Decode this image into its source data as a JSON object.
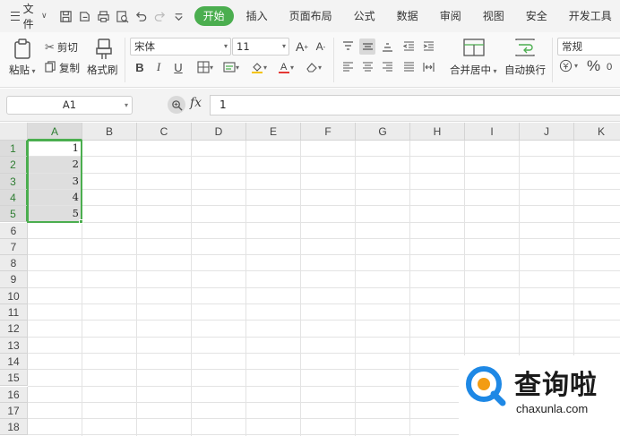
{
  "menubar": {
    "file_label": "文件",
    "tabs": [
      {
        "label": "开始"
      },
      {
        "label": "插入"
      },
      {
        "label": "页面布局"
      },
      {
        "label": "公式"
      },
      {
        "label": "数据"
      },
      {
        "label": "审阅"
      },
      {
        "label": "视图"
      },
      {
        "label": "安全"
      },
      {
        "label": "开发工具"
      }
    ],
    "active_tab": "开始",
    "accent_color": "#4bae4f"
  },
  "ribbon": {
    "paste_label": "粘贴",
    "cut_label": "剪切",
    "copy_label": "复制",
    "format_painter_label": "格式刷",
    "font_name": "宋体",
    "font_size": "11",
    "bold": "B",
    "italic": "I",
    "underline": "U",
    "merge_label": "合并居中",
    "wrap_label": "自动换行",
    "number_format": "常规",
    "percent_symbol": "%"
  },
  "formula_bar": {
    "name_box": "A1",
    "fx_label": "fx",
    "formula_value": "1"
  },
  "sheet": {
    "columns": [
      "A",
      "B",
      "C",
      "D",
      "E",
      "F",
      "G",
      "H",
      "I",
      "J",
      "K"
    ],
    "rows": [
      "1",
      "2",
      "3",
      "4",
      "5",
      "6",
      "7",
      "8",
      "9",
      "10",
      "11",
      "12",
      "13",
      "14",
      "15",
      "16",
      "17",
      "18"
    ],
    "selected_column": "A",
    "selected_rows": [
      "1",
      "2",
      "3",
      "4",
      "5"
    ],
    "cells": [
      {
        "ref": "A1",
        "value": "1"
      },
      {
        "ref": "A2",
        "value": "2"
      },
      {
        "ref": "A3",
        "value": "3"
      },
      {
        "ref": "A4",
        "value": "4"
      },
      {
        "ref": "A5",
        "value": "5"
      }
    ]
  },
  "watermark": {
    "brand": "查询啦",
    "url": "chaxunla.com",
    "logo_color": "#1e88e5",
    "logo_accent": "#f39c12"
  }
}
